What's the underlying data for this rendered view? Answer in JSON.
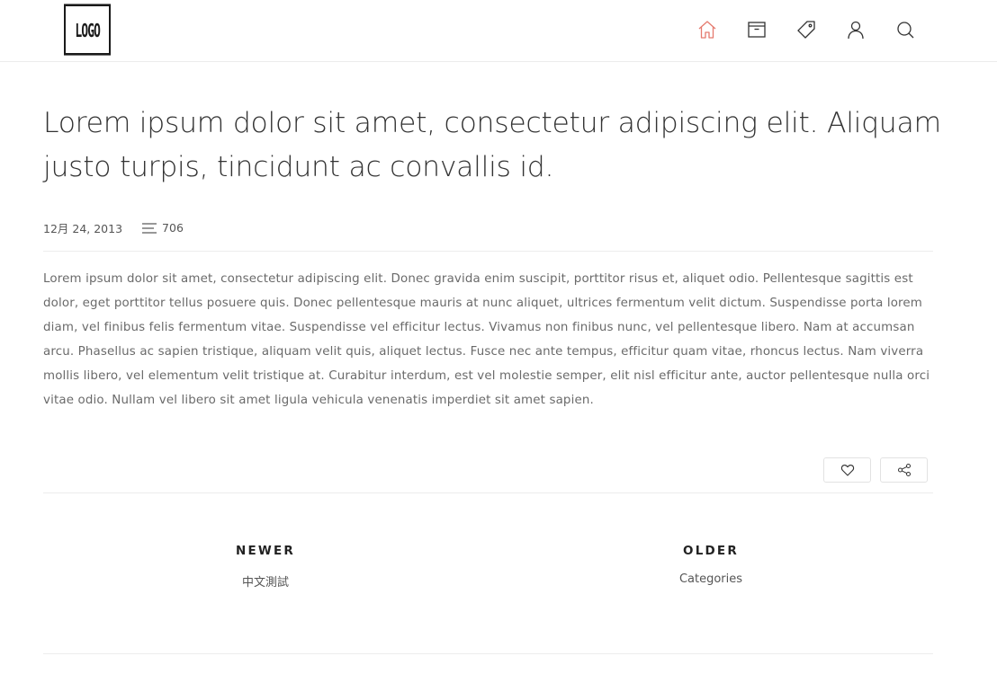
{
  "header": {
    "logo_text": "LOGO",
    "nav": [
      {
        "icon": "home-icon",
        "active": true
      },
      {
        "icon": "archive-icon",
        "active": false
      },
      {
        "icon": "tag-icon",
        "active": false
      },
      {
        "icon": "user-icon",
        "active": false
      },
      {
        "icon": "search-icon",
        "active": false
      }
    ],
    "accent_color": "#e57a6e"
  },
  "post": {
    "title": "Lorem ipsum dolor sit amet, consectetur adipiscing elit. Aliquam justo turpis, tincidunt ac convallis id.",
    "date": "12月 24, 2013",
    "word_count": "706",
    "body": "Lorem ipsum dolor sit amet, consectetur adipiscing elit. Donec gravida enim suscipit, porttitor risus et, aliquet odio. Pellentesque sagittis est dolor, eget porttitor tellus posuere quis. Donec pellentesque mauris at nunc aliquet, ultrices fermentum velit dictum. Suspendisse porta lorem diam, vel finibus felis fermentum vitae. Suspendisse vel efficitur lectus. Vivamus non finibus nunc, vel pellentesque libero. Nam at accumsan arcu. Phasellus ac sapien tristique, aliquam velit quis, aliquet lectus. Fusce nec ante tempus, efficitur quam vitae, rhoncus lectus. Nam viverra mollis libero, vel elementum velit tristique at. Curabitur interdum, est vel molestie semper, elit nisl efficitur ante, auctor pellentesque nulla orci vitae odio. Nullam vel libero sit amet ligula vehicula venenatis imperdiet sit amet sapien.",
    "actions": [
      {
        "icon": "heart-icon"
      },
      {
        "icon": "share-icon"
      }
    ]
  },
  "pagination": {
    "newer": {
      "label": "NEWER",
      "link": "中文測試"
    },
    "older": {
      "label": "OLDER",
      "link": "Categories"
    }
  }
}
